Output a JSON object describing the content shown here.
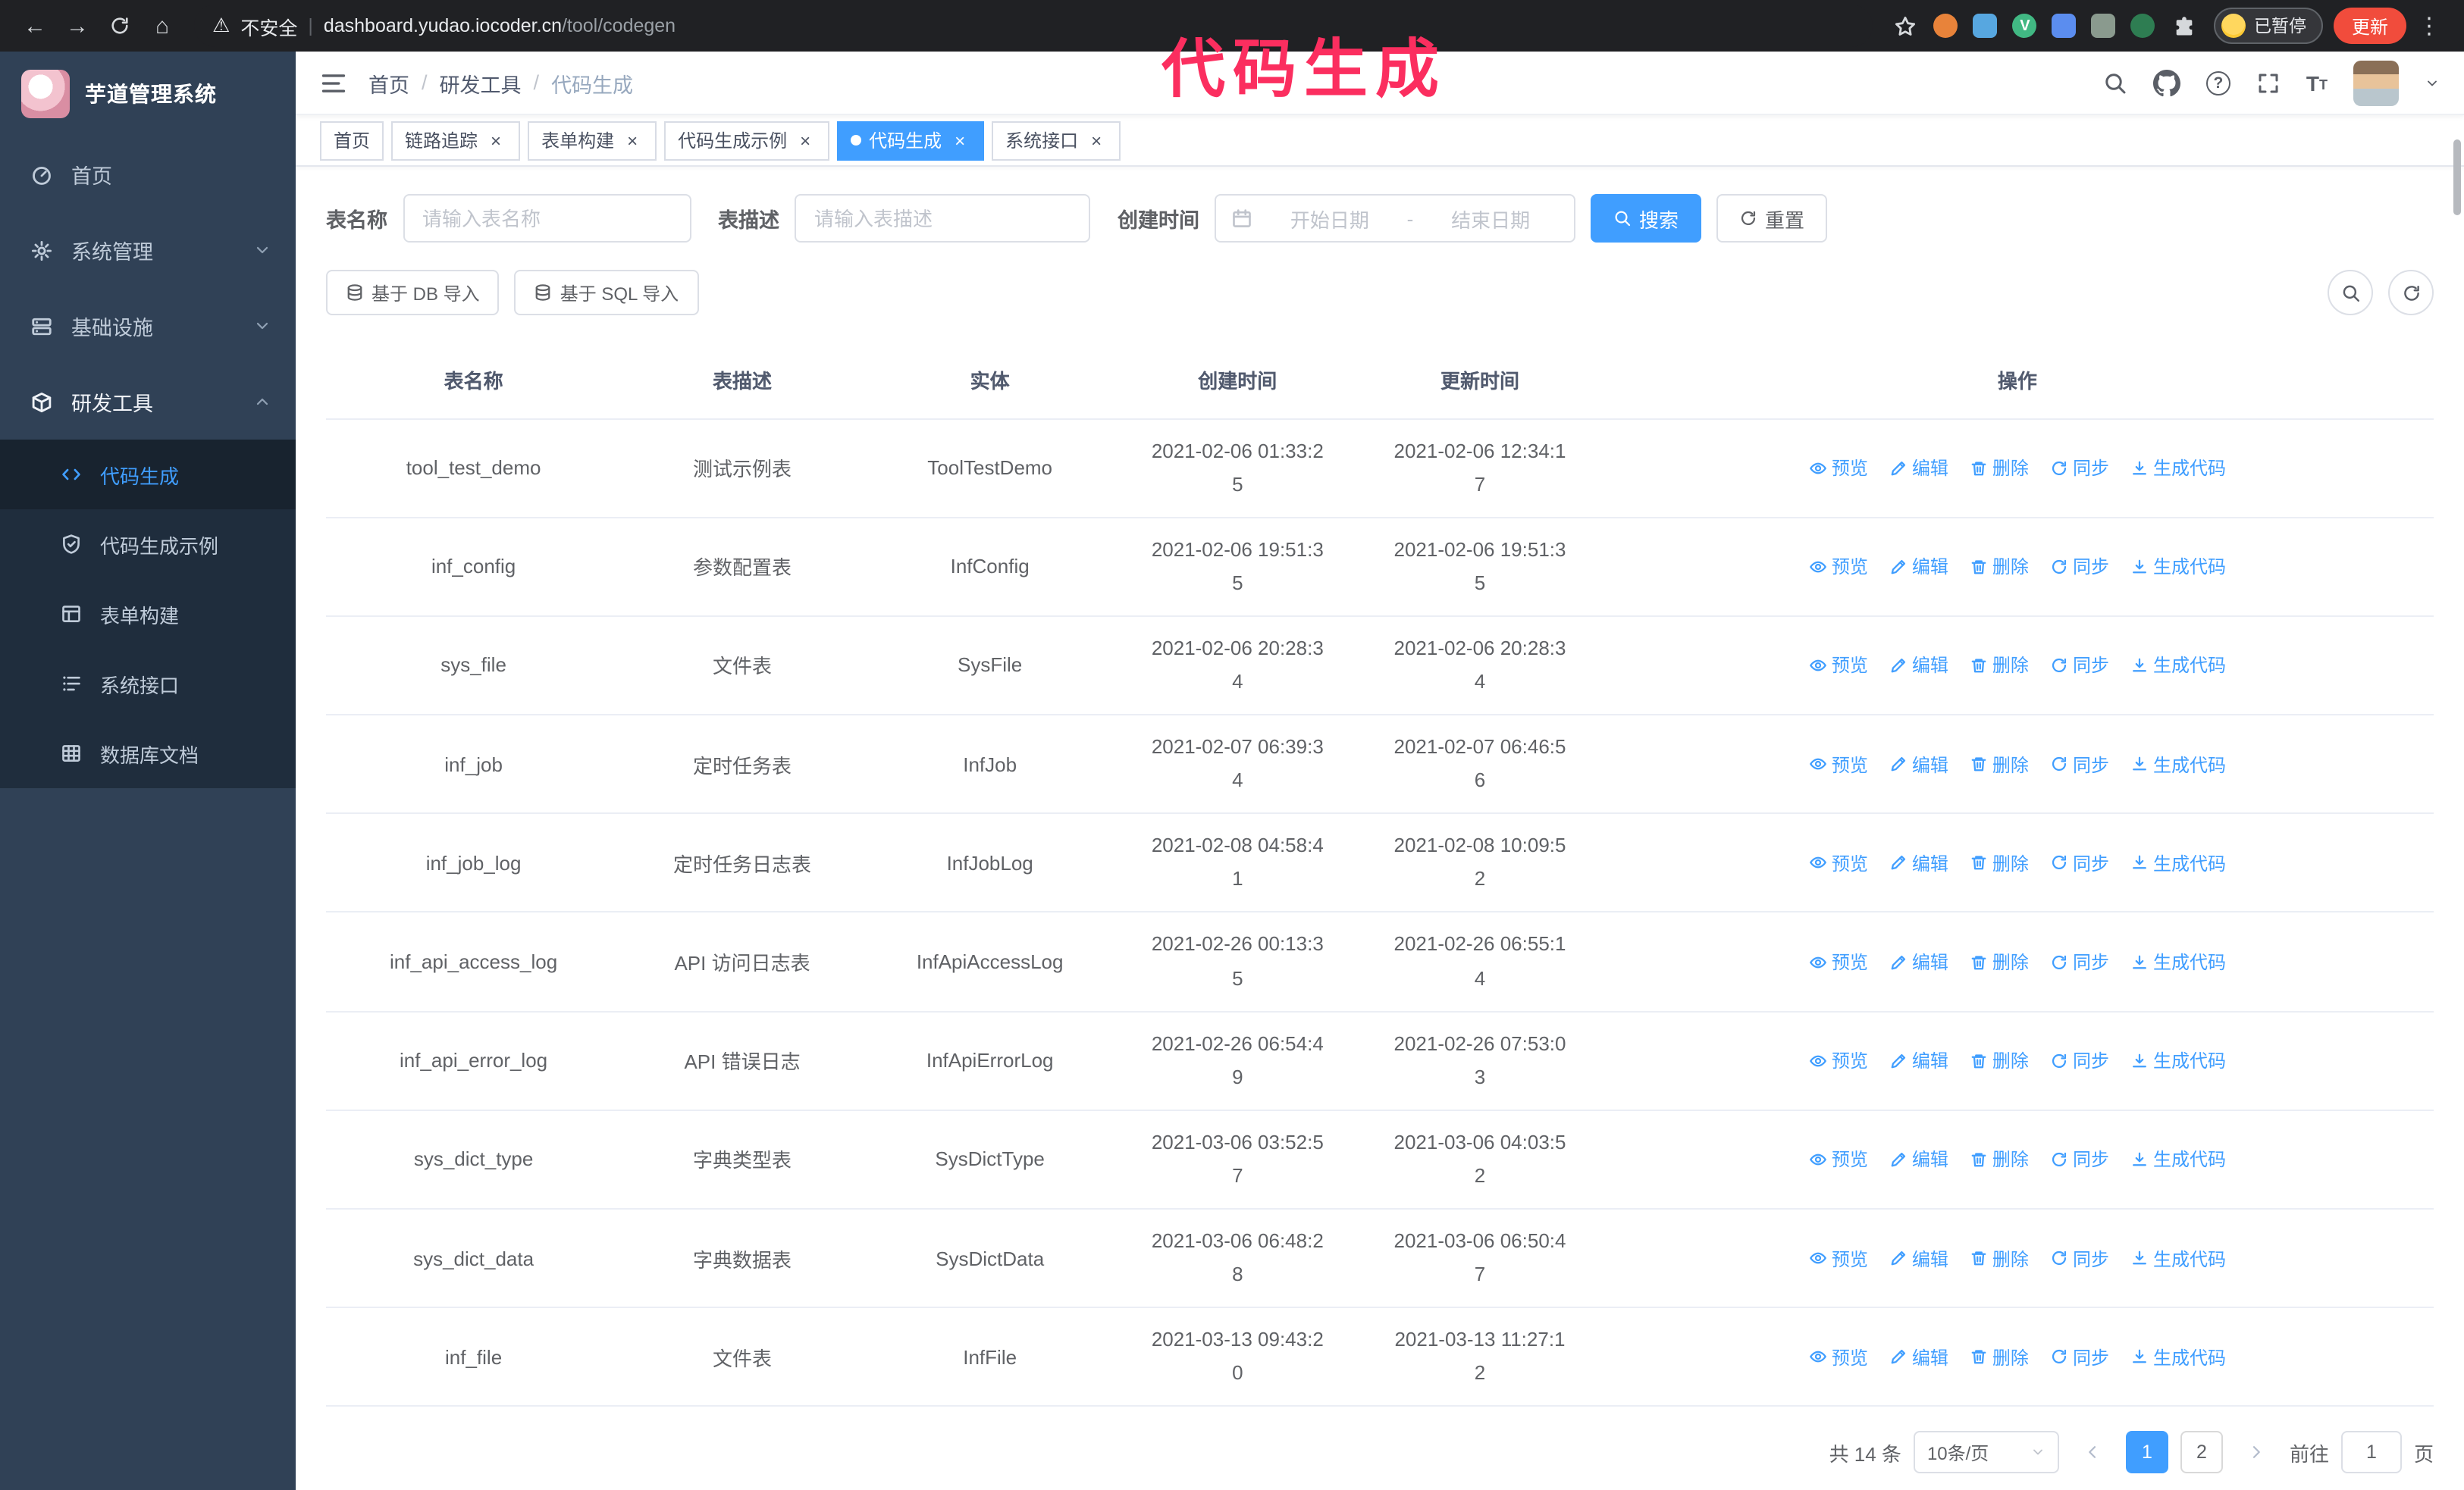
{
  "colors": {
    "primary": "#409eff",
    "sidebar_bg": "#304156",
    "submenu_bg": "#1f2d3d",
    "annotation": "#fb2e5f",
    "update_button_bg": "#f14c3c",
    "chrome_bg": "#202124"
  },
  "browser": {
    "security_label": "不安全",
    "url_host": "dashboard.yudao.iocoder.cn",
    "url_path": "/tool/codegen",
    "profile_badge": "已暂停",
    "update_button": "更新",
    "icons": [
      "back-arrow",
      "forward-arrow",
      "reload",
      "home",
      "warning-triangle",
      "bookmark-star",
      "orange-extension",
      "blue-extension",
      "vue-devtools",
      "contacts-extension",
      "grid-extension",
      "leaf-extension",
      "extensions-puzzle",
      "kebab-menu"
    ]
  },
  "annotation": {
    "text": "代码生成"
  },
  "sidebar": {
    "logo_title": "芋道管理系统",
    "items": [
      {
        "label": "首页",
        "icon": "dashboard-icon"
      },
      {
        "label": "系统管理",
        "icon": "gear-icon"
      },
      {
        "label": "基础设施",
        "icon": "server-icon"
      },
      {
        "label": "研发工具",
        "icon": "toolbox-icon"
      }
    ],
    "subitems": [
      {
        "label": "代码生成",
        "icon": "code-icon",
        "active": true
      },
      {
        "label": "代码生成示例",
        "icon": "shield-icon"
      },
      {
        "label": "表单构建",
        "icon": "form-icon"
      },
      {
        "label": "系统接口",
        "icon": "api-list-icon"
      },
      {
        "label": "数据库文档",
        "icon": "database-grid-icon"
      }
    ]
  },
  "header": {
    "breadcrumb": [
      "首页",
      "研发工具",
      "代码生成"
    ]
  },
  "tabs": [
    "首页",
    "链路追踪",
    "表单构建",
    "代码生成示例",
    "代码生成",
    "系统接口"
  ],
  "search": {
    "table_name_label": "表名称",
    "table_name_placeholder": "请输入表名称",
    "table_desc_label": "表描述",
    "table_desc_placeholder": "请输入表描述",
    "create_time_label": "创建时间",
    "start_date_placeholder": "开始日期",
    "date_separator": "-",
    "end_date_placeholder": "结束日期",
    "search_button": "搜索",
    "reset_button": "重置"
  },
  "toolbar": {
    "import_db": "基于 DB 导入",
    "import_sql": "基于 SQL 导入"
  },
  "table": {
    "columns": [
      "表名称",
      "表描述",
      "实体",
      "创建时间",
      "更新时间",
      "操作"
    ],
    "actions": [
      "预览",
      "编辑",
      "删除",
      "同步",
      "生成代码"
    ],
    "rows": [
      {
        "name": "tool_test_demo",
        "desc": "测试示例表",
        "entity": "ToolTestDemo",
        "created": "2021-02-06 01:33:25",
        "updated": "2021-02-06 12:34:17"
      },
      {
        "name": "inf_config",
        "desc": "参数配置表",
        "entity": "InfConfig",
        "created": "2021-02-06 19:51:35",
        "updated": "2021-02-06 19:51:35"
      },
      {
        "name": "sys_file",
        "desc": "文件表",
        "entity": "SysFile",
        "created": "2021-02-06 20:28:34",
        "updated": "2021-02-06 20:28:34"
      },
      {
        "name": "inf_job",
        "desc": "定时任务表",
        "entity": "InfJob",
        "created": "2021-02-07 06:39:34",
        "updated": "2021-02-07 06:46:56"
      },
      {
        "name": "inf_job_log",
        "desc": "定时任务日志表",
        "entity": "InfJobLog",
        "created": "2021-02-08 04:58:41",
        "updated": "2021-02-08 10:09:52"
      },
      {
        "name": "inf_api_access_log",
        "desc": "API 访问日志表",
        "entity": "InfApiAccessLog",
        "created": "2021-02-26 00:13:35",
        "updated": "2021-02-26 06:55:14"
      },
      {
        "name": "inf_api_error_log",
        "desc": "API 错误日志",
        "entity": "InfApiErrorLog",
        "created": "2021-02-26 06:54:49",
        "updated": "2021-02-26 07:53:03"
      },
      {
        "name": "sys_dict_type",
        "desc": "字典类型表",
        "entity": "SysDictType",
        "created": "2021-03-06 03:52:57",
        "updated": "2021-03-06 04:03:52"
      },
      {
        "name": "sys_dict_data",
        "desc": "字典数据表",
        "entity": "SysDictData",
        "created": "2021-03-06 06:48:28",
        "updated": "2021-03-06 06:50:47"
      },
      {
        "name": "inf_file",
        "desc": "文件表",
        "entity": "InfFile",
        "created": "2021-03-13 09:43:20",
        "updated": "2021-03-13 11:27:12"
      }
    ]
  },
  "pagination": {
    "total": "共 14 条",
    "page_size": "10条/页",
    "pages": [
      "1",
      "2"
    ],
    "goto_label": "前往",
    "goto_value": "1",
    "page_label": "页"
  }
}
